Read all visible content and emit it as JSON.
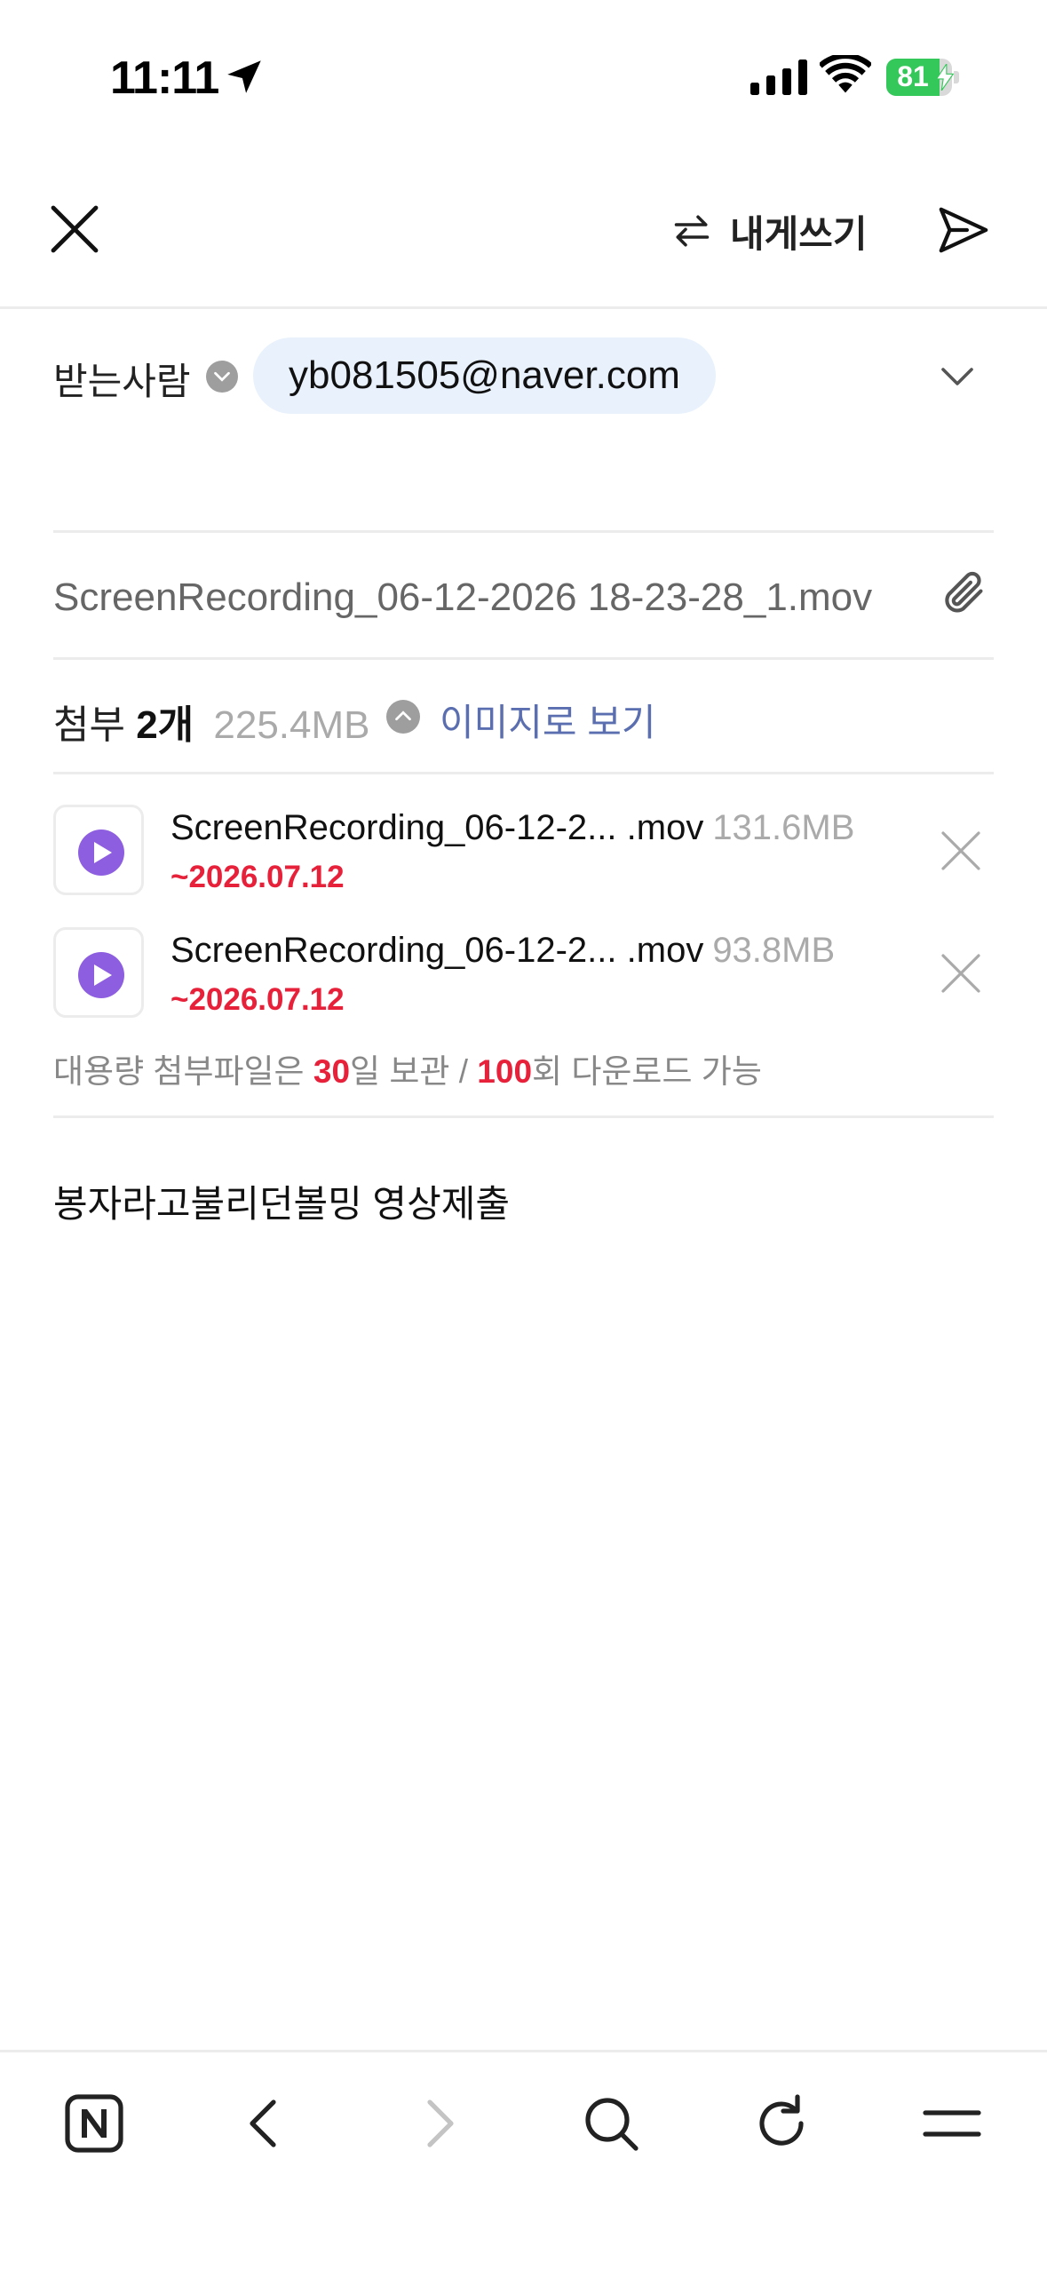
{
  "status_bar": {
    "time": "11:11",
    "battery_level": "81",
    "battery_fraction": 0.81
  },
  "toolbar": {
    "self_write_label": "내게쓰기"
  },
  "recipient": {
    "label": "받는사람",
    "email": "yb081505@naver.com"
  },
  "subject": {
    "value": "ScreenRecording_06-12-2026 18-23-28_1.mov"
  },
  "attachments": {
    "label": "첨부",
    "count": "2개",
    "total_size": "225.4MB",
    "view_as_images": "이미지로 보기",
    "files": [
      {
        "name": "ScreenRecording_06-12-2... .mov",
        "size": "131.6MB",
        "expires": "~2026.07.12"
      },
      {
        "name": "ScreenRecording_06-12-2...  .mov",
        "size": "93.8MB",
        "expires": "~2026.07.12"
      }
    ],
    "notice": {
      "prefix": "대용량 첨부파일은 ",
      "days": "30",
      "mid": "일 보관 / ",
      "downloads": "100",
      "suffix": "회 다운로드 가능"
    }
  },
  "body": {
    "text": "봉자라고불리던볼밍 영상제출"
  },
  "colors": {
    "accent_red": "#e8213b",
    "link_blue": "#5b6fb0",
    "chip_bg": "#e8f1fc",
    "play_purple": "#8d5fe0",
    "battery_green": "#34c759"
  },
  "icons": {
    "status": [
      "location-arrow-icon",
      "cellular-signal-icon",
      "wifi-icon",
      "battery-icon"
    ],
    "toolbar": [
      "close-icon",
      "swap-arrows-icon",
      "send-icon"
    ],
    "nav": [
      "naver-n-icon",
      "back-icon",
      "forward-icon",
      "search-icon",
      "refresh-icon",
      "menu-icon"
    ]
  }
}
